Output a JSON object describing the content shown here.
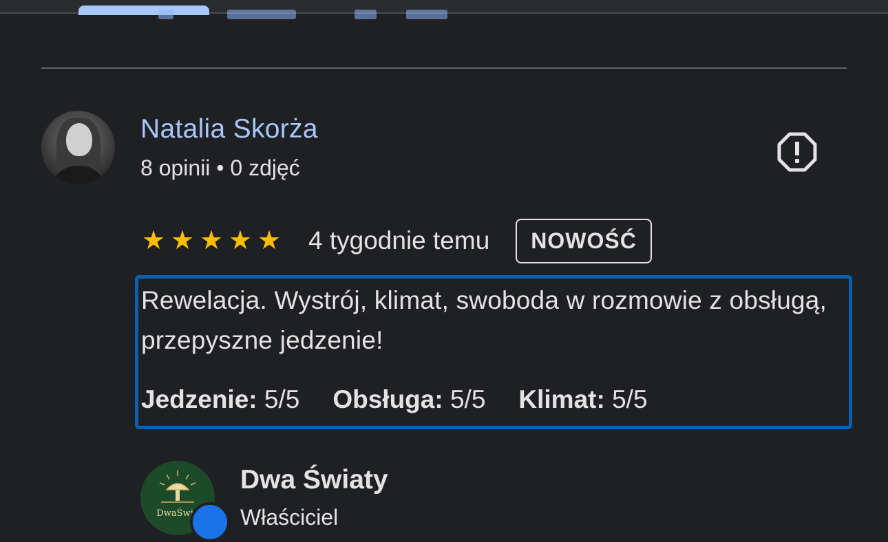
{
  "review": {
    "reviewer_name": "Natalia Skorża",
    "reviewer_meta": "8 opinii • 0 zdjęć",
    "rating": 5,
    "rating_max": 5,
    "date": "4 tygodnie temu",
    "badge": "NOWOŚĆ",
    "text": "Rewelacja. Wystrój, klimat, swoboda w rozmowie z obsługą, przepyszne jedzenie!",
    "sub_ratings": [
      {
        "label": "Jedzenie:",
        "value": "5/5"
      },
      {
        "label": "Obsługa:",
        "value": "5/5"
      },
      {
        "label": "Klimat:",
        "value": "5/5"
      }
    ],
    "highlight_color": "#0b5fb0"
  },
  "owner_response": {
    "name": "Dwa Światy",
    "role": "Właściciel",
    "logo_text": "DwaŚwia"
  },
  "icons": {
    "report": "report-flag-octagon-icon",
    "star": "star-icon",
    "verified": "verified-check-icon"
  },
  "colors": {
    "link": "#a8c7fa",
    "star": "#fbbc04",
    "background": "#1f2023"
  }
}
